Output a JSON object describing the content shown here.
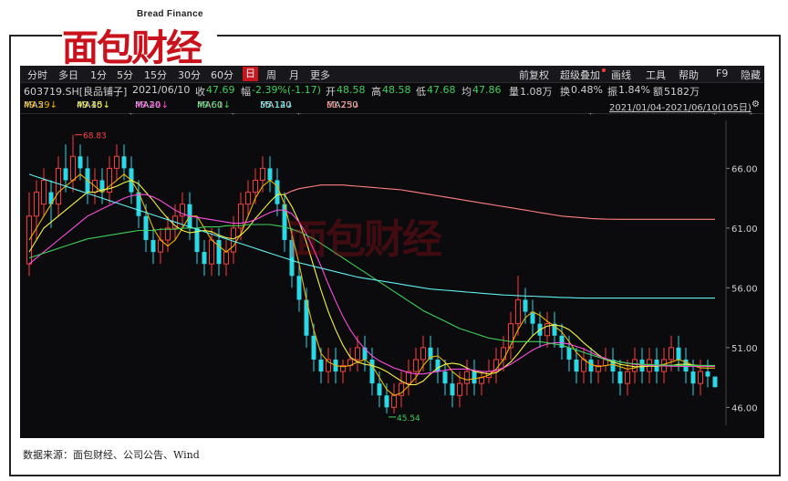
{
  "logo": {
    "cn": "面包财经",
    "en": "Bread Finance"
  },
  "toolbar": {
    "tabs": [
      "分时",
      "多日",
      "1分",
      "5分",
      "15分",
      "30分",
      "60分",
      "日",
      "周",
      "月",
      "更多"
    ],
    "active_tab": "日",
    "right_items": [
      "前复权",
      "叠加",
      "画线",
      "工具",
      "帮助",
      "F9",
      "隐藏"
    ],
    "right_item_prefix": "超级"
  },
  "quote": {
    "code_name": "603719.SH[良品铺子]",
    "date": "2021/06/10",
    "close_label": "收",
    "close": "47.69",
    "change_label": "幅",
    "change": "-2.39%(-1.17)",
    "open_label": "开",
    "open": "48.58",
    "high_label": "高",
    "high": "48.58",
    "low_label": "低",
    "low": "47.68",
    "avg_label": "均",
    "avg": "47.86",
    "volume_label": "量",
    "volume": "1.08万",
    "turnover_label": "换",
    "turnover": "0.48%",
    "amplitude_label": "振",
    "amplitude": "1.84%",
    "amount_label": "额",
    "amount": "5182万"
  },
  "ma_row": {
    "items": [
      {
        "name": "MA5",
        "value": "49.29↓",
        "color": "#f0b400"
      },
      {
        "name": "MA10",
        "value": "49.45↓",
        "color": "#f5f545"
      },
      {
        "name": "MA20",
        "value": "49.44↓",
        "color": "#ff4de0"
      },
      {
        "name": "MA60",
        "value": "49.51↓",
        "color": "#3fcf59"
      },
      {
        "name": "MA120",
        "value": "55.14↓",
        "color": "#5ff0f0"
      },
      {
        "name": "MA250",
        "value": "61.73↓",
        "color": "#ff8080"
      }
    ],
    "range": "2021/01/04-2021/06/10(105日)"
  },
  "chart_data": {
    "type": "candlestick",
    "ylim": [
      44.5,
      70.0
    ],
    "y_ticks": [
      "66.00",
      "61.00",
      "56.00",
      "51.00",
      "46.00"
    ],
    "annotations": {
      "high": "68.83",
      "low": "45.54"
    },
    "colors": {
      "up": "#ff3b3b",
      "down": "#2ad8e6"
    },
    "candles": [
      [
        58,
        62,
        64,
        57
      ],
      [
        62,
        64,
        65,
        60
      ],
      [
        63,
        65,
        66,
        62
      ],
      [
        64,
        63,
        65,
        61
      ],
      [
        63,
        66,
        67,
        62
      ],
      [
        66,
        65,
        68,
        64
      ],
      [
        65,
        67,
        68.8,
        64
      ],
      [
        67,
        66,
        68,
        65
      ],
      [
        66,
        64,
        67,
        63
      ],
      [
        64,
        65,
        66,
        63
      ],
      [
        65,
        64,
        66,
        63
      ],
      [
        64,
        66,
        67,
        63
      ],
      [
        66,
        67,
        68,
        65
      ],
      [
        67,
        66,
        68,
        65
      ],
      [
        66,
        64,
        67,
        63
      ],
      [
        64,
        62,
        65,
        61
      ],
      [
        62,
        60,
        63,
        59
      ],
      [
        60,
        59,
        61,
        58
      ],
      [
        59,
        60,
        61,
        58
      ],
      [
        60,
        61,
        62,
        59
      ],
      [
        61,
        62,
        63,
        60
      ],
      [
        62,
        63,
        64,
        61
      ],
      [
        63,
        61,
        64,
        60
      ],
      [
        61,
        59,
        62,
        58
      ],
      [
        59,
        58,
        60,
        57
      ],
      [
        58,
        60,
        61,
        57
      ],
      [
        60,
        58,
        61,
        57
      ],
      [
        58,
        59,
        60,
        57
      ],
      [
        59,
        61,
        62,
        58
      ],
      [
        61,
        63,
        64,
        60
      ],
      [
        63,
        64,
        65,
        62
      ],
      [
        64,
        65,
        66,
        63
      ],
      [
        65,
        66,
        67,
        64
      ],
      [
        66,
        65,
        67,
        64
      ],
      [
        65,
        63,
        66,
        62
      ],
      [
        63,
        60,
        64,
        59
      ],
      [
        60,
        57,
        61,
        56
      ],
      [
        57,
        55,
        58,
        54
      ],
      [
        55,
        52,
        56,
        51
      ],
      [
        52,
        50,
        53,
        49
      ],
      [
        50,
        49,
        51,
        48
      ],
      [
        49,
        50,
        51,
        48
      ],
      [
        50,
        49,
        51,
        48
      ],
      [
        49,
        49.5,
        50,
        48
      ],
      [
        49.5,
        50,
        51,
        49
      ],
      [
        50,
        51,
        52,
        49
      ],
      [
        51,
        50,
        52,
        49
      ],
      [
        50,
        48,
        51,
        47
      ],
      [
        48,
        47,
        49,
        46
      ],
      [
        47,
        46,
        48,
        45.5
      ],
      [
        46,
        47,
        48,
        45.5
      ],
      [
        47,
        48,
        49,
        46
      ],
      [
        48,
        49,
        50,
        47
      ],
      [
        49,
        50,
        51,
        48
      ],
      [
        50,
        51,
        52,
        49
      ],
      [
        51,
        50,
        52,
        49
      ],
      [
        50,
        49,
        51,
        48
      ],
      [
        49,
        48,
        50,
        47
      ],
      [
        48,
        47,
        49,
        46
      ],
      [
        47,
        48,
        49,
        46
      ],
      [
        48,
        49,
        50,
        47
      ],
      [
        49,
        48,
        50,
        47
      ],
      [
        48,
        48.5,
        49,
        47
      ],
      [
        48.5,
        49,
        50,
        48
      ],
      [
        49,
        50,
        51,
        48
      ],
      [
        50,
        51,
        52,
        49
      ],
      [
        51,
        53,
        54,
        50
      ],
      [
        53,
        55,
        57,
        52
      ],
      [
        55,
        54,
        56,
        53
      ],
      [
        54,
        53,
        55,
        52
      ],
      [
        53,
        52,
        54,
        51
      ],
      [
        52,
        53,
        54,
        51
      ],
      [
        53,
        52,
        54,
        51
      ],
      [
        52,
        51,
        53,
        50
      ],
      [
        51,
        50,
        52,
        49
      ],
      [
        50,
        49,
        51,
        48
      ],
      [
        49,
        50,
        51,
        48
      ],
      [
        50,
        49,
        51,
        48
      ],
      [
        49,
        49.5,
        50,
        48
      ],
      [
        49.5,
        50,
        51,
        49
      ],
      [
        50,
        49,
        51,
        48
      ],
      [
        49,
        48,
        50,
        47
      ],
      [
        48,
        49,
        50,
        47
      ],
      [
        49,
        50,
        51,
        48
      ],
      [
        50,
        49,
        51,
        48
      ],
      [
        49,
        50,
        51,
        48
      ],
      [
        50,
        49,
        51,
        48
      ],
      [
        49,
        50,
        51,
        48
      ],
      [
        50,
        51,
        52,
        49
      ],
      [
        51,
        50,
        52,
        49
      ],
      [
        50,
        49,
        51,
        48
      ],
      [
        49,
        48,
        50,
        47
      ],
      [
        48,
        49,
        50,
        47
      ],
      [
        49,
        48.58,
        50,
        47.68
      ],
      [
        48.58,
        47.69,
        48.58,
        47.68
      ]
    ],
    "series": [
      {
        "name": "MA5",
        "color": "#f0b400",
        "values": [
          60,
          61,
          62,
          63,
          64,
          64.5,
          65,
          65.5,
          65,
          64.5,
          64,
          64.5,
          65,
          65.5,
          65,
          64,
          62.5,
          61,
          60,
          59.5,
          60,
          61,
          62,
          62,
          61,
          60,
          59.5,
          59,
          59.5,
          60.5,
          62,
          63.5,
          64.5,
          65,
          64.5,
          63,
          60.5,
          58,
          55,
          52.5,
          50.5,
          49.8,
          49.5,
          49.4,
          49.5,
          49.8,
          50,
          49.5,
          48.5,
          47.5,
          47,
          47.2,
          47.8,
          48.5,
          49.5,
          50.2,
          50.3,
          49.8,
          49,
          48.5,
          48.3,
          48.4,
          48.5,
          48.7,
          49.2,
          50,
          51.2,
          52.5,
          53.5,
          54,
          53.7,
          53.2,
          52.8,
          52.3,
          51.5,
          50.6,
          50,
          49.6,
          49.4,
          49.5,
          49.6,
          49.4,
          49.2,
          49.3,
          49.5,
          49.6,
          49.5,
          49.6,
          49.8,
          50,
          49.8,
          49.5,
          49.3,
          49.29,
          49.29
        ]
      },
      {
        "name": "MA10",
        "color": "#f5f545",
        "values": [
          59,
          60,
          61,
          61.5,
          62,
          62.5,
          63,
          63.5,
          64,
          64,
          64.2,
          64.3,
          64.5,
          64.8,
          65,
          64.7,
          64,
          63.3,
          62.5,
          61.8,
          61.2,
          60.8,
          60.6,
          60.7,
          60.8,
          60.7,
          60.4,
          60.2,
          60.1,
          60.4,
          61,
          61.8,
          62.5,
          63.2,
          63.8,
          63.8,
          62.8,
          61.5,
          59.8,
          57.8,
          55.8,
          54,
          52.5,
          51.2,
          50.2,
          49.8,
          49.6,
          49.5,
          49.3,
          49,
          48.6,
          48.2,
          47.9,
          47.9,
          48.2,
          48.8,
          49.3,
          49.6,
          49.7,
          49.6,
          49.3,
          49,
          48.9,
          48.8,
          48.9,
          49.3,
          49.8,
          50.5,
          51.3,
          52,
          52.5,
          52.8,
          52.9,
          52.8,
          52.5,
          52,
          51.4,
          50.9,
          50.4,
          50,
          49.8,
          49.6,
          49.5,
          49.4,
          49.4,
          49.45,
          49.45,
          49.5,
          49.5,
          49.6,
          49.6,
          49.55,
          49.5,
          49.45,
          49.45
        ]
      },
      {
        "name": "MA20",
        "color": "#ff4de0",
        "values": [
          58,
          58.5,
          59,
          59.5,
          60,
          60.5,
          61,
          61.5,
          62,
          62.3,
          62.6,
          62.9,
          63.2,
          63.5,
          63.7,
          63.8,
          63.8,
          63.6,
          63.3,
          62.9,
          62.5,
          62.2,
          62,
          61.9,
          61.8,
          61.7,
          61.6,
          61.5,
          61.4,
          61.4,
          61.5,
          61.7,
          62,
          62.3,
          62.5,
          62.5,
          62.2,
          61.5,
          60.5,
          59.2,
          57.8,
          56.3,
          54.9,
          53.6,
          52.5,
          51.6,
          50.9,
          50.3,
          49.9,
          49.6,
          49.3,
          49.1,
          48.9,
          48.8,
          48.8,
          48.9,
          49,
          49.1,
          49.2,
          49.2,
          49.2,
          49.1,
          49,
          49,
          49.1,
          49.3,
          49.6,
          50,
          50.4,
          50.8,
          51.1,
          51.3,
          51.4,
          51.4,
          51.3,
          51.1,
          50.9,
          50.6,
          50.3,
          50.1,
          49.9,
          49.8,
          49.7,
          49.6,
          49.55,
          49.5,
          49.5,
          49.47,
          49.45,
          49.44,
          49.44,
          49.44,
          49.44,
          49.44,
          49.44
        ]
      },
      {
        "name": "MA60",
        "color": "#3fcf59",
        "values": [
          58.5,
          58.7,
          58.9,
          59.1,
          59.3,
          59.5,
          59.7,
          59.9,
          60.1,
          60.2,
          60.3,
          60.4,
          60.5,
          60.6,
          60.7,
          60.8,
          60.8,
          60.8,
          60.9,
          60.9,
          60.9,
          61,
          61,
          61,
          61.1,
          61.1,
          61.1,
          61.2,
          61.2,
          61.2,
          61.3,
          61.3,
          61.3,
          61.3,
          61.2,
          61.1,
          60.9,
          60.7,
          60.4,
          60.1,
          59.7,
          59.3,
          58.9,
          58.5,
          58.1,
          57.7,
          57.3,
          56.9,
          56.5,
          56.1,
          55.7,
          55.3,
          54.9,
          54.5,
          54.1,
          53.8,
          53.5,
          53.2,
          52.9,
          52.6,
          52.4,
          52.2,
          52,
          51.8,
          51.7,
          51.6,
          51.5,
          51.5,
          51.5,
          51.5,
          51.5,
          51.4,
          51.3,
          51.2,
          51,
          50.8,
          50.6,
          50.4,
          50.2,
          50,
          49.9,
          49.8,
          49.7,
          49.65,
          49.6,
          49.57,
          49.55,
          49.53,
          49.52,
          49.51,
          49.51,
          49.51,
          49.51,
          49.51,
          49.51
        ]
      },
      {
        "name": "MA120",
        "color": "#5ff0f0",
        "values": [
          65.5,
          65.3,
          65.1,
          64.9,
          64.7,
          64.5,
          64.3,
          64.1,
          63.9,
          63.7,
          63.5,
          63.3,
          63.1,
          62.9,
          62.7,
          62.5,
          62.3,
          62.1,
          61.9,
          61.7,
          61.5,
          61.3,
          61.1,
          60.9,
          60.7,
          60.5,
          60.3,
          60.1,
          59.9,
          59.7,
          59.5,
          59.3,
          59.1,
          58.9,
          58.7,
          58.5,
          58.3,
          58.1,
          57.95,
          57.8,
          57.65,
          57.5,
          57.35,
          57.2,
          57.05,
          56.9,
          56.8,
          56.7,
          56.6,
          56.5,
          56.4,
          56.3,
          56.2,
          56.1,
          56,
          55.9,
          55.85,
          55.8,
          55.75,
          55.7,
          55.65,
          55.6,
          55.55,
          55.5,
          55.45,
          55.4,
          55.38,
          55.35,
          55.32,
          55.3,
          55.27,
          55.25,
          55.22,
          55.2,
          55.18,
          55.16,
          55.14,
          55.14,
          55.14,
          55.14,
          55.14,
          55.14,
          55.14,
          55.14,
          55.14,
          55.14,
          55.14,
          55.14,
          55.14,
          55.14,
          55.14,
          55.14,
          55.14,
          55.14,
          55.14
        ]
      },
      {
        "name": "MA250",
        "color": "#ff8080",
        "values": [
          null,
          null,
          null,
          null,
          null,
          null,
          null,
          null,
          null,
          null,
          null,
          null,
          null,
          null,
          null,
          null,
          null,
          null,
          null,
          null,
          null,
          null,
          null,
          null,
          null,
          null,
          null,
          null,
          null,
          null,
          null,
          null,
          null,
          null,
          null,
          63.8,
          64.1,
          64.3,
          64.4,
          64.5,
          64.6,
          64.6,
          64.6,
          64.6,
          64.55,
          64.5,
          64.45,
          64.4,
          64.35,
          64.3,
          64.25,
          64.2,
          64.1,
          64,
          63.9,
          63.8,
          63.7,
          63.6,
          63.5,
          63.4,
          63.3,
          63.2,
          63.1,
          63,
          62.9,
          62.8,
          62.7,
          62.6,
          62.5,
          62.4,
          62.3,
          62.2,
          62.1,
          62,
          61.95,
          61.9,
          61.85,
          61.8,
          61.77,
          61.75,
          61.74,
          61.73,
          61.73,
          61.73,
          61.73,
          61.73,
          61.73,
          61.73,
          61.73,
          61.73,
          61.73,
          61.73,
          61.73,
          61.73,
          61.73
        ]
      }
    ],
    "star_markers": [
      14,
      28,
      37,
      77,
      94,
      99
    ]
  },
  "watermark": "面包财经",
  "source": "数据来源：面包财经、公司公告、Wind"
}
